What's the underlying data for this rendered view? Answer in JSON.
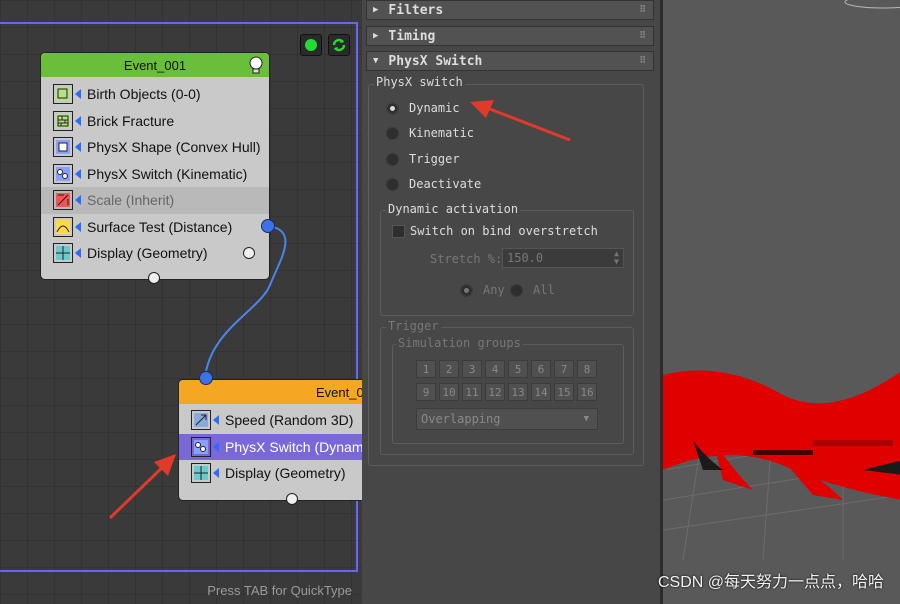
{
  "graph": {
    "hint": "Press TAB for QuickType",
    "event1": {
      "title": "Event_001",
      "operators": [
        {
          "label": "Birth Objects (0-0)",
          "icon": "birth-objects-icon"
        },
        {
          "label": "Brick Fracture",
          "icon": "brick-fracture-icon"
        },
        {
          "label": "PhysX Shape (Convex Hull)",
          "icon": "physx-shape-icon"
        },
        {
          "label": "PhysX Switch (Kinematic)",
          "icon": "physx-switch-icon"
        },
        {
          "label": "Scale (Inherit)",
          "icon": "scale-icon",
          "disabled": true
        },
        {
          "label": "Surface Test (Distance)",
          "icon": "surface-test-icon"
        },
        {
          "label": "Display (Geometry)",
          "icon": "display-icon"
        }
      ]
    },
    "event2": {
      "title": "Event_0",
      "operators": [
        {
          "label": "Speed (Random 3D)",
          "icon": "speed-icon"
        },
        {
          "label": "PhysX Switch (Dynami",
          "icon": "physx-switch-icon",
          "selected": true
        },
        {
          "label": "Display (Geometry)",
          "icon": "display-icon"
        }
      ]
    }
  },
  "panel": {
    "rollouts": [
      "Filters",
      "Timing",
      "PhysX Switch"
    ],
    "physx_group": "PhysX switch",
    "modes": [
      "Dynamic",
      "Kinematic",
      "Trigger",
      "Deactivate"
    ],
    "selected_mode": "Dynamic",
    "dyn_group": "Dynamic activation",
    "switch_label": "Switch on bind overstretch",
    "stretch_label": "Stretch %:",
    "stretch_value": "150.0",
    "any_label": "Any",
    "all_label": "All",
    "trigger_group": "Trigger",
    "sim_group": "Simulation groups",
    "groups_row1": [
      "1",
      "2",
      "3",
      "4",
      "5",
      "6",
      "7",
      "8"
    ],
    "groups_row2": [
      "9",
      "10",
      "11",
      "12",
      "13",
      "14",
      "15",
      "16"
    ],
    "overlap": "Overlapping"
  },
  "watermark": "CSDN @每天努力一点点，哈哈",
  "colors": {
    "accent": "#6666ff",
    "event1_header": "#6abf3a",
    "event2_header": "#f5a623",
    "selected": "#7a68d8",
    "annotation": "#e03a2a",
    "wire": "#4a86e8"
  }
}
